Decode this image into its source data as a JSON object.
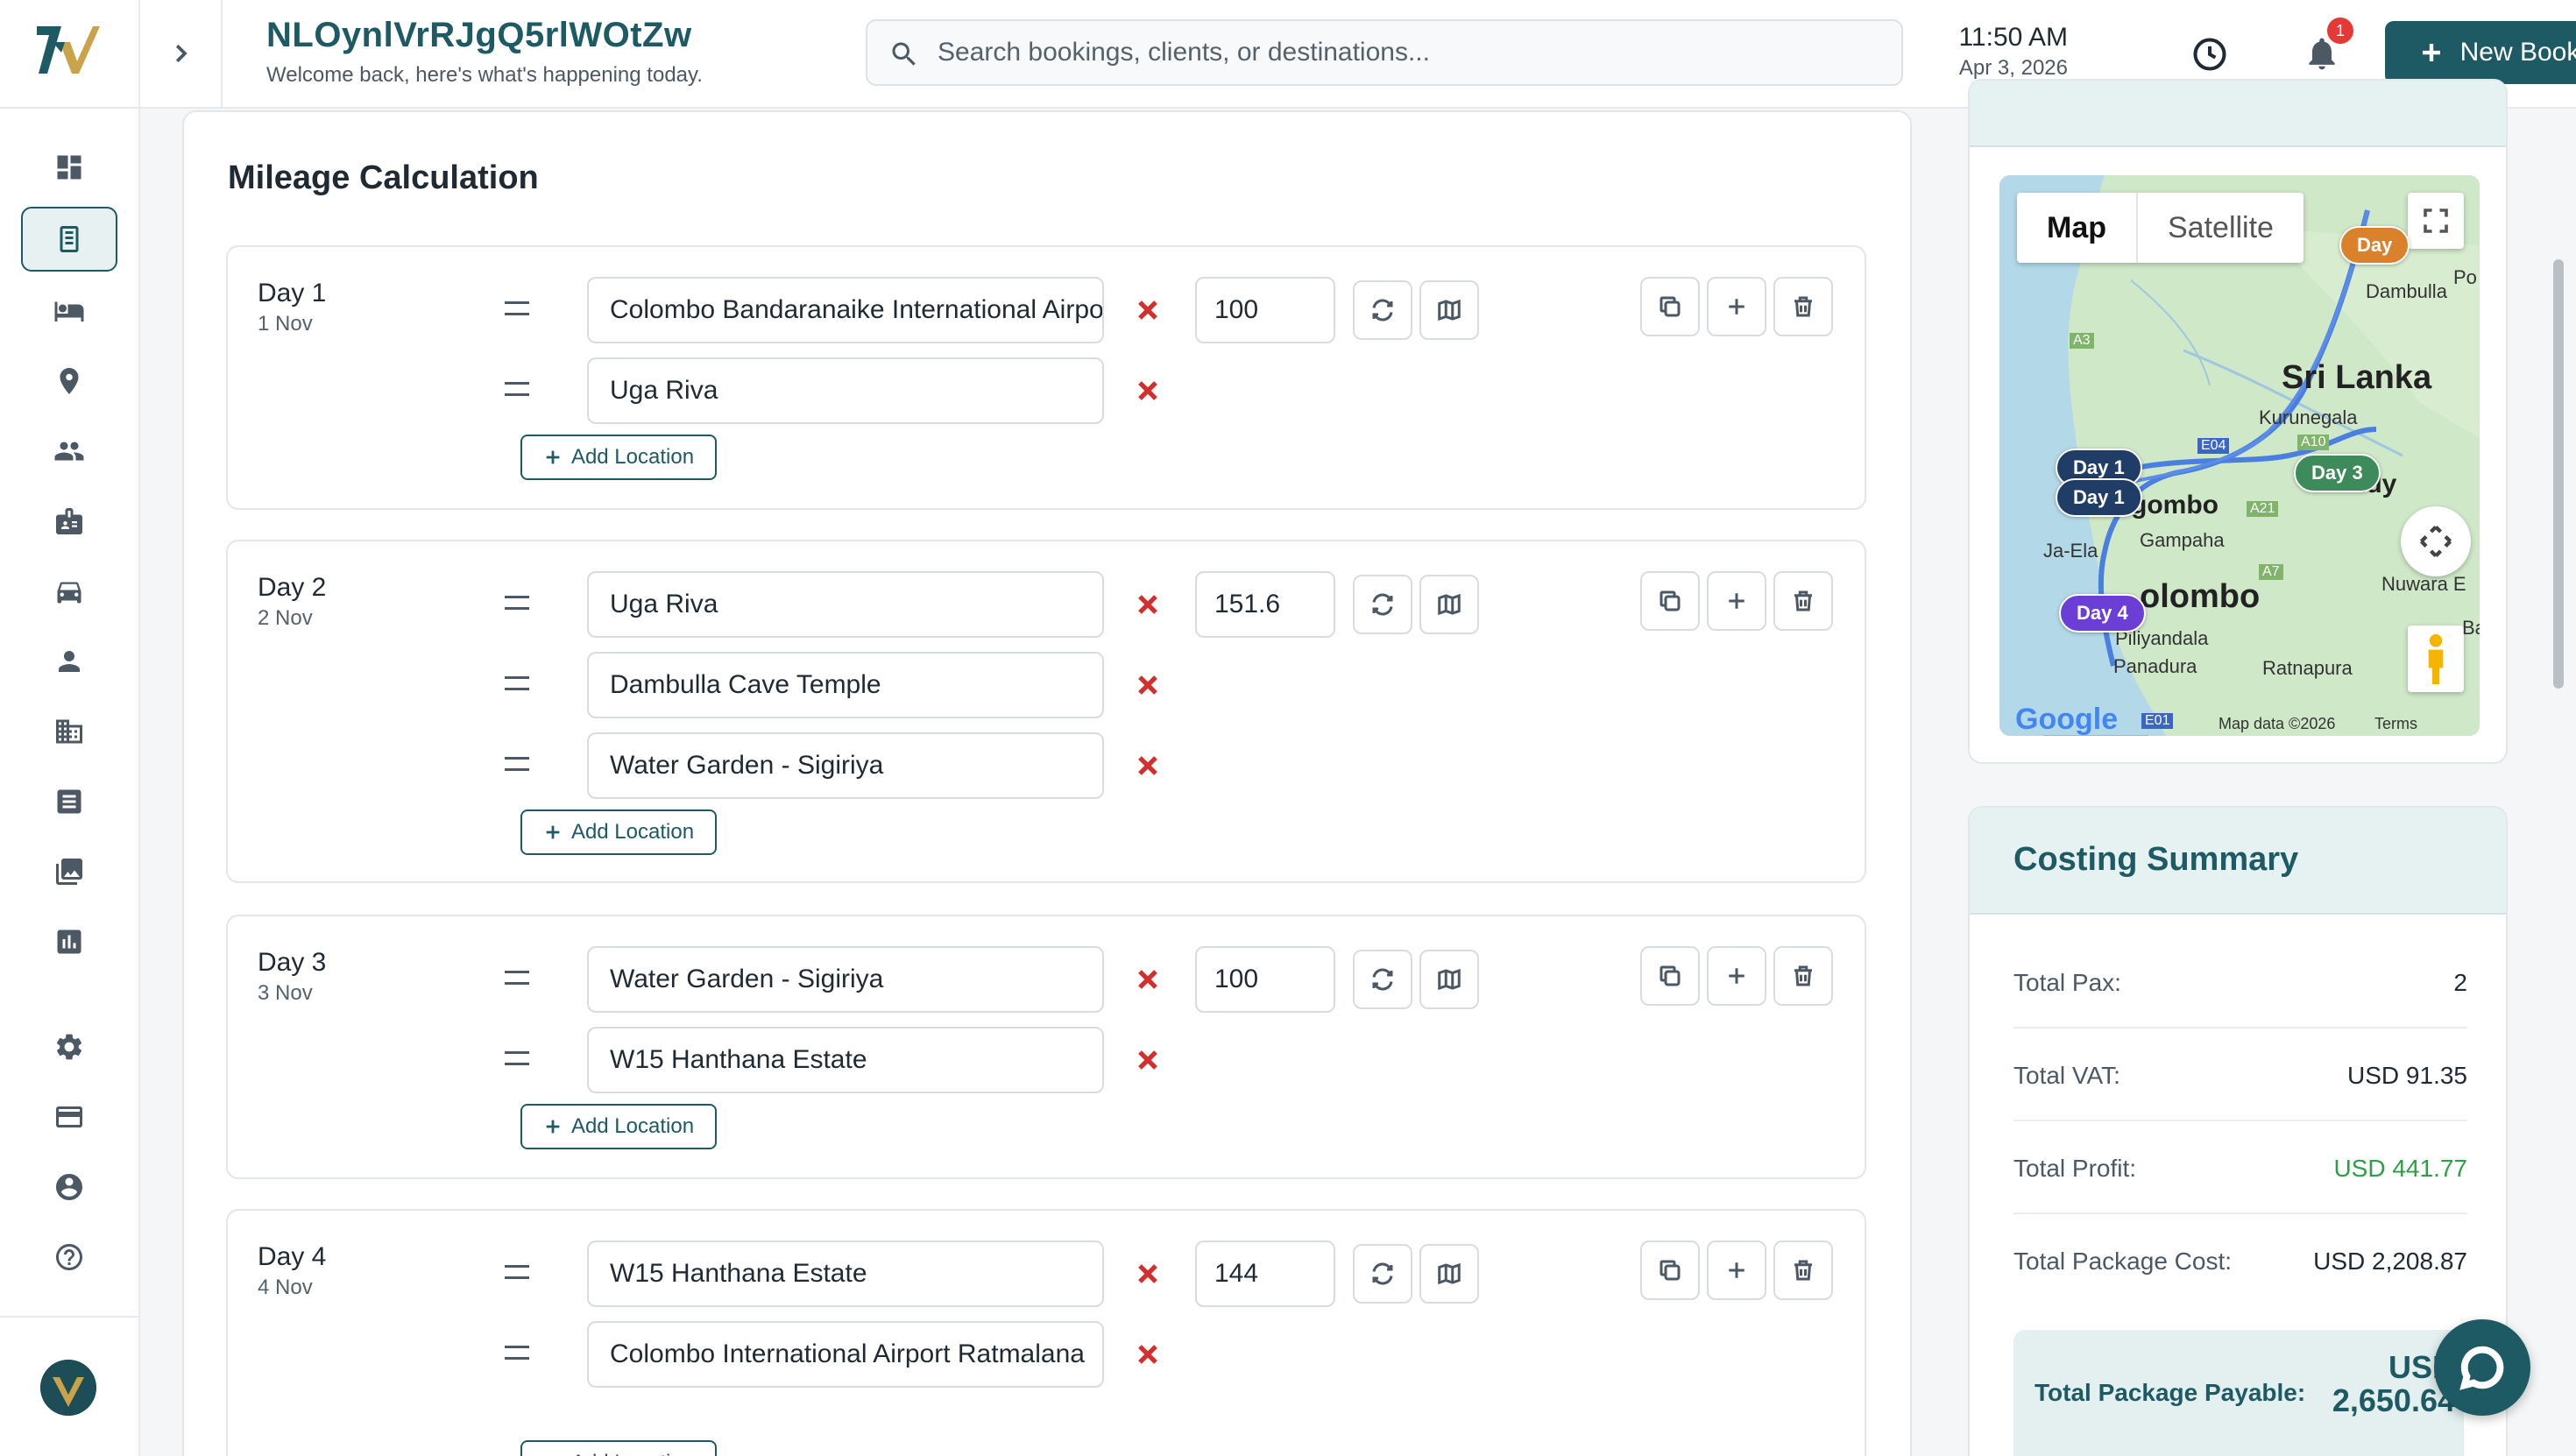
{
  "header": {
    "title": "NLOynlVrRJgQ5rlWOtZw",
    "subtitle": "Welcome back, here's what's happening today.",
    "search_placeholder": "Search bookings, clients, or destinations...",
    "time": "11:50 AM",
    "date": "Apr 3, 2026",
    "notification_count": "1",
    "new_booking_label": "New Booking"
  },
  "sidebar": {
    "items": [
      {
        "icon": "dashboard-icon"
      },
      {
        "icon": "bookings-icon",
        "active": true
      },
      {
        "icon": "hotel-bed-icon"
      },
      {
        "icon": "location-pin-icon"
      },
      {
        "icon": "people-icon"
      },
      {
        "icon": "badge-icon"
      },
      {
        "icon": "car-icon"
      },
      {
        "icon": "person-icon"
      },
      {
        "icon": "building-icon"
      },
      {
        "icon": "receipt-icon"
      },
      {
        "icon": "gallery-icon"
      },
      {
        "icon": "report-chart-icon"
      },
      {
        "icon": "settings-gear-icon"
      },
      {
        "icon": "credit-card-icon"
      },
      {
        "icon": "account-circle-icon"
      },
      {
        "icon": "help-icon"
      }
    ]
  },
  "mileage": {
    "title": "Mileage Calculation",
    "add_location_label": "Add Location",
    "days": [
      {
        "title": "Day 1",
        "date": "1 Nov",
        "km": "100",
        "locations": [
          "Colombo Bandaranaike International Airport",
          "Uga Riva"
        ]
      },
      {
        "title": "Day 2",
        "date": "2 Nov",
        "km": "151.6",
        "locations": [
          "Uga Riva",
          "Dambulla Cave Temple",
          "Water Garden - Sigiriya"
        ]
      },
      {
        "title": "Day 3",
        "date": "3 Nov",
        "km": "100",
        "locations": [
          "Water Garden - Sigiriya",
          "W15 Hanthana Estate"
        ]
      },
      {
        "title": "Day 4",
        "date": "4 Nov",
        "km": "144",
        "locations": [
          "W15 Hanthana Estate",
          "Colombo International Airport Ratmalana"
        ]
      }
    ]
  },
  "map": {
    "tab_map": "Map",
    "tab_satellite": "Satellite",
    "markers": [
      "Day 1",
      "Day 1",
      "Day 3",
      "Day 4",
      "Day"
    ],
    "labels": {
      "sri_lanka": "Sri Lanka",
      "dambulla": "Dambulla",
      "kurunegala": "Kurunegala",
      "negombo": "gombo",
      "kandy": "ndy",
      "ja_ela": "Ja-Ela",
      "gampaha": "Gampaha",
      "colombo": "olombo",
      "nuwara": "Nuwara E",
      "piliyandala": "Piliyandala",
      "panadura": "Panadura",
      "ratnapura": "Ratnapura",
      "a3": "A3",
      "a10": "A10",
      "a21": "A21",
      "a7": "A7",
      "e04": "E04",
      "e01": "E01",
      "po": "Po",
      "ba": "Ba"
    },
    "google": "Google",
    "map_data": "Map data ©2026",
    "terms": "Terms",
    "colors": {
      "day1": "#1f3d66",
      "day3": "#3d8b5a",
      "day4": "#6b3fd6",
      "day_other": "#d9822b",
      "route": "#4a7fe0"
    }
  },
  "costing": {
    "title": "Costing Summary",
    "rows": [
      {
        "label": "Total Pax:",
        "value": "2"
      },
      {
        "label": "Total VAT:",
        "value": "USD 91.35"
      },
      {
        "label": "Total Profit:",
        "value": "USD 441.77"
      },
      {
        "label": "Total Package Cost:",
        "value": "USD 2,208.87"
      }
    ],
    "payable_label": "Total Package Payable:",
    "payable_value": "USD 2,650.64"
  },
  "colors": {
    "brand": "#1d5a63",
    "danger": "#d32f2f",
    "profit": "#2e9e48"
  }
}
